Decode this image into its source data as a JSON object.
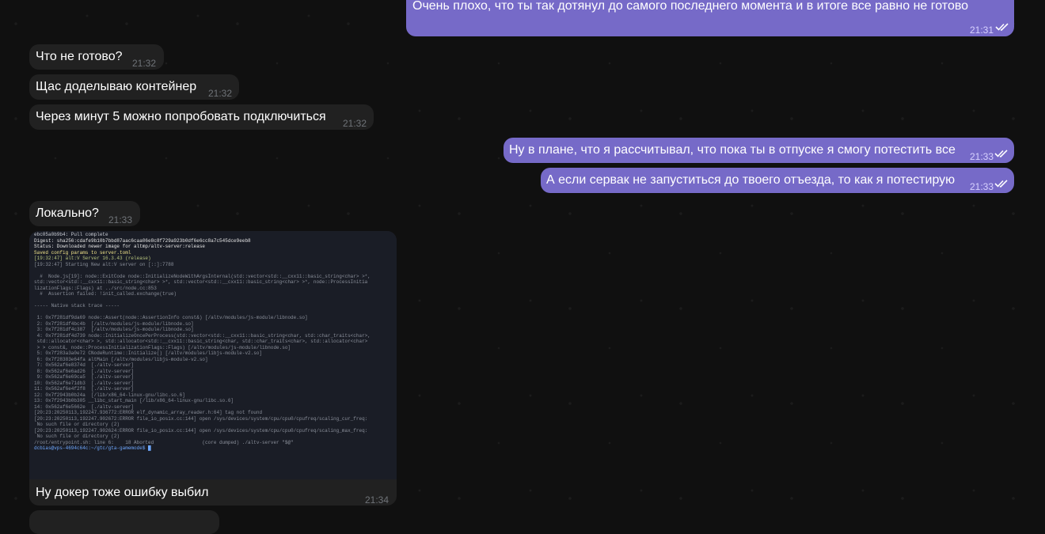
{
  "chat": {
    "messages": [
      {
        "id": "m1",
        "dir": "out",
        "text": "Очень плохо, что ты так дотянул до самого последнего момента и в итоге все равно не готово",
        "time": "21:31"
      },
      {
        "id": "m2",
        "dir": "in",
        "text": "Что не готово?",
        "time": "21:32"
      },
      {
        "id": "m3",
        "dir": "in",
        "text": "Щас доделываю контейнер",
        "time": "21:32"
      },
      {
        "id": "m4",
        "dir": "in",
        "text": "Через минут 5 можно попробовать подключиться",
        "time": "21:32"
      },
      {
        "id": "m5",
        "dir": "out",
        "text": "Ну в плане, что я рассчитывал, что пока ты в отпуске я смогу потестить все",
        "time": "21:33"
      },
      {
        "id": "m6",
        "dir": "out",
        "text": "А если сервак не запуститься до твоего отъезда, то как я потестирую",
        "time": "21:33"
      },
      {
        "id": "m7",
        "dir": "in",
        "text": "Локально?",
        "time": "21:33"
      },
      {
        "id": "m8",
        "dir": "in",
        "text": "Ну докер тоже ошибку выбил",
        "time": "21:34"
      }
    ],
    "screenshot_lines": [
      {
        "t": "ebc05a0b9b4: Pull complete",
        "c": "#c9ccd4"
      },
      {
        "t": "Digest: sha256:cdafe9b10b7bbd87aac6caa06e8c8f729a923b0df6e6cc8a7c545dce9eeb8",
        "c": "#e6e6e6"
      },
      {
        "t": "Status: Downloaded newer image for altmp/altv-server:release",
        "c": "#e6e6e6"
      },
      {
        "t": "Saved config params to server.toml",
        "c": "#f2e58a"
      },
      {
        "t": "[19:32:47] alt:V Server 16.3.43 (release)",
        "c": "#b7c47e"
      },
      {
        "t": "[19:32:47] Starting New alt:V server on [::]:7788",
        "c": "#8a8f9a"
      },
      {
        "t": "",
        "c": "#8a8f9a"
      },
      {
        "t": "  #  Node.js[19]: node::ExitCode node::InitializeNodeWithArgsInternal(std::vector<std::__cxx11::basic_string<char> >*,",
        "c": "#8a8f9a"
      },
      {
        "t": "std::vector<std::__cxx11::basic_string<char> >*, std::vector<std::__cxx11::basic_string<char> >*, node::ProcessInitia",
        "c": "#8a8f9a"
      },
      {
        "t": "lizationFlags::Flags) at ../src/node.cc:853",
        "c": "#8a8f9a"
      },
      {
        "t": "  #  Assertion failed: !init_called.exchange(true)",
        "c": "#8a8f9a"
      },
      {
        "t": "",
        "c": "#8a8f9a"
      },
      {
        "t": "----- Native stack trace -----",
        "c": "#8a8f9a"
      },
      {
        "t": "",
        "c": "#8a8f9a"
      },
      {
        "t": " 1: 0x7f281df9da69 node::Assert(node::AssertionInfo const&) [/altv/modules/js-module/libnode.so]",
        "c": "#8a8f9a"
      },
      {
        "t": " 2: 0x7f281df4bc4b  [/altv/modules/js-module/libnode.so]",
        "c": "#8a8f9a"
      },
      {
        "t": " 3: 0x7f281df4c387  [/altv/modules/js-module/libnode.so]",
        "c": "#8a8f9a"
      },
      {
        "t": " 4: 0x7f281df4d739 node::InitializeOncePerProcess(std::vector<std::__cxx11::basic_string<char, std::char_traits<char>,",
        "c": "#8a8f9a"
      },
      {
        "t": " std::allocator<char> >, std::allocator<std::__cxx11::basic_string<char, std::char_traits<char>, std::allocator<char>",
        "c": "#8a8f9a"
      },
      {
        "t": " > > const&, node::ProcessInitializationFlags::Flags) [/altv/modules/js-module/libnode.so]",
        "c": "#8a8f9a"
      },
      {
        "t": " 5: 0x7f283a3a0e72 CNodeRuntime::Initialize() [/altv/modules/libjs-module-v2.so]",
        "c": "#8a8f9a"
      },
      {
        "t": " 6: 0x7f28383e64fa altMain [/altv/modules/libjs-module-v2.so]",
        "c": "#8a8f9a"
      },
      {
        "t": " 7: 0x562af6e8374d  [./altv-server]",
        "c": "#8a8f9a"
      },
      {
        "t": " 8: 0x562af6e6ad26  [./altv-server]",
        "c": "#8a8f9a"
      },
      {
        "t": " 9: 0x562af6e69ca5  [./altv-server]",
        "c": "#8a8f9a"
      },
      {
        "t": "10: 0x562af6e71db3  [./altv-server]",
        "c": "#8a8f9a"
      },
      {
        "t": "11: 0x562af6e4f2f8  [./altv-server]",
        "c": "#8a8f9a"
      },
      {
        "t": "12: 0x7f2943b0b24a  [/lib/x86_64-linux-gnu/libc.so.6]",
        "c": "#8a8f9a"
      },
      {
        "t": "13: 0x7f2943b0b305 __libc_start_main [/lib/x86_64-linux-gnu/libc.so.6]",
        "c": "#8a8f9a"
      },
      {
        "t": "14: 0x562af6e5662e  [./altv-server]",
        "c": "#8a8f9a"
      },
      {
        "t": "[20:23:20250113,192247.936772:ERROR elf_dynamic_array_reader.h:64] tag not found",
        "c": "#8a8f9a"
      },
      {
        "t": "[20:23:20250113,192247.902672:ERROR file_io_posix.cc:144] open /sys/devices/system/cpu/cpu0/cpufreq/scaling_cur_freq:",
        "c": "#8a8f9a"
      },
      {
        "t": " No such file or directory (2)",
        "c": "#8a8f9a"
      },
      {
        "t": "[20:23:20250113,192247.902624:ERROR file_io_posix.cc:144] open /sys/devices/system/cpu/cpu0/cpufreq/scaling_max_freq:",
        "c": "#8a8f9a"
      },
      {
        "t": " No such file or directory (2)",
        "c": "#8a8f9a"
      },
      {
        "t": "/root/entrypoint.sh: line 6:    18 Aborted                 (core dumped) ./altv-server \"$@\"",
        "c": "#8a8f9a"
      },
      {
        "t": "dcbias@vps-4694c64c:~/gtc/gta-gamemode$ █",
        "c": "#6fa8ff"
      }
    ]
  }
}
